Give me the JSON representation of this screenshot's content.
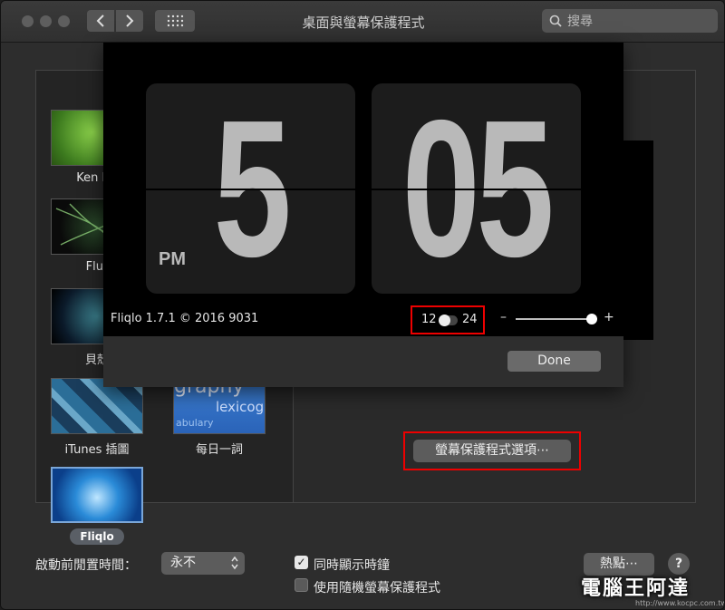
{
  "window": {
    "title": "桌面與螢幕保護程式"
  },
  "search": {
    "placeholder": "搜尋"
  },
  "screensavers": [
    {
      "label": "Ken Bu"
    },
    {
      "label": "Flur"
    },
    {
      "label": "貝殼"
    },
    {
      "label": "iTunes 插圖"
    },
    {
      "label": "每日一詞"
    },
    {
      "label": "Fliqlo"
    }
  ],
  "word_thumb": {
    "line1": "graphy",
    "line2": "lexicog",
    "line3": "abulary"
  },
  "fliqlo_sheet": {
    "hour": "5",
    "minute": "05",
    "meridiem": "PM",
    "version": "Fliqlo 1.7.1 © 2016 9031",
    "format_12": "12",
    "format_24": "24",
    "size_minus": "–",
    "size_plus": "+",
    "done_label": "Done"
  },
  "options_button": "螢幕保護程式選項⋯",
  "bottom": {
    "start_label": "啟動前閒置時間：",
    "start_value": "永不",
    "show_clock_label": "同時顯示時鐘",
    "show_clock_checked": true,
    "random_label": "使用隨機螢幕保護程式",
    "random_checked": false,
    "hot_corners_label": "熱點⋯",
    "help_label": "?"
  },
  "watermark": {
    "text": "電腦王阿達",
    "sub": "http://www.kocpc.com.tw"
  },
  "colors": {
    "highlight_frame": "#e00000",
    "sheet_bg": "#000000"
  }
}
